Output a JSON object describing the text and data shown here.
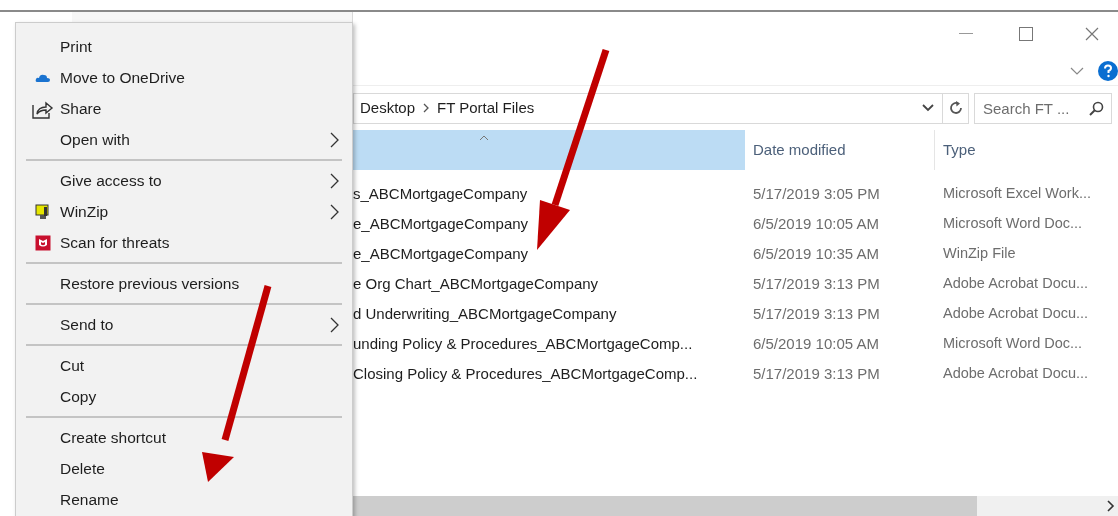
{
  "address_bar": {
    "path": [
      "Desktop",
      "FT Portal Files"
    ]
  },
  "search": {
    "placeholder": "Search FT ..."
  },
  "table": {
    "columns": [
      {
        "selected": true
      },
      {
        "label": "Date modified",
        "selected": false
      },
      {
        "label": "Type",
        "selected": false
      }
    ],
    "rows": [
      {
        "name": "s_ABCMortgageCompany",
        "date": "5/17/2019 3:05 PM",
        "type": "Microsoft Excel Work..."
      },
      {
        "name": "e_ABCMortgageCompany",
        "date": "6/5/2019 10:05 AM",
        "type": "Microsoft Word Doc..."
      },
      {
        "name": "e_ABCMortgageCompany",
        "date": "6/5/2019 10:35 AM",
        "type": "WinZip File"
      },
      {
        "name": "e Org Chart_ABCMortgageCompany",
        "date": "5/17/2019 3:13 PM",
        "type": "Adobe Acrobat Docu..."
      },
      {
        "name": "d Underwriting_ABCMortgageCompany",
        "date": "5/17/2019 3:13 PM",
        "type": "Adobe Acrobat Docu..."
      },
      {
        "name": "unding Policy & Procedures_ABCMortgageComp...",
        "date": "6/5/2019 10:05 AM",
        "type": "Microsoft Word Doc..."
      },
      {
        "name": "Closing Policy & Procedures_ABCMortgageComp...",
        "date": "5/17/2019 3:13 PM",
        "type": "Adobe Acrobat Docu..."
      }
    ]
  },
  "context_menu": {
    "items": [
      {
        "kind": "item",
        "label": "Print",
        "submenu": false
      },
      {
        "kind": "item",
        "label": "Move to OneDrive",
        "submenu": false
      },
      {
        "kind": "item",
        "label": "Share",
        "submenu": false
      },
      {
        "kind": "item",
        "label": "Open with",
        "submenu": true
      },
      {
        "kind": "separator"
      },
      {
        "kind": "item",
        "label": "Give access to",
        "submenu": true
      },
      {
        "kind": "item",
        "label": "WinZip",
        "submenu": true
      },
      {
        "kind": "item",
        "label": "Scan for threats",
        "submenu": false
      },
      {
        "kind": "separator"
      },
      {
        "kind": "item",
        "label": "Restore previous versions",
        "submenu": false
      },
      {
        "kind": "separator"
      },
      {
        "kind": "item",
        "label": "Send to",
        "submenu": true
      },
      {
        "kind": "separator"
      },
      {
        "kind": "item",
        "label": "Cut",
        "submenu": false
      },
      {
        "kind": "item",
        "label": "Copy",
        "submenu": false
      },
      {
        "kind": "separator"
      },
      {
        "kind": "item",
        "label": "Create shortcut",
        "submenu": false
      },
      {
        "kind": "item",
        "label": "Delete",
        "submenu": false
      },
      {
        "kind": "item",
        "label": "Rename",
        "submenu": false
      }
    ]
  }
}
